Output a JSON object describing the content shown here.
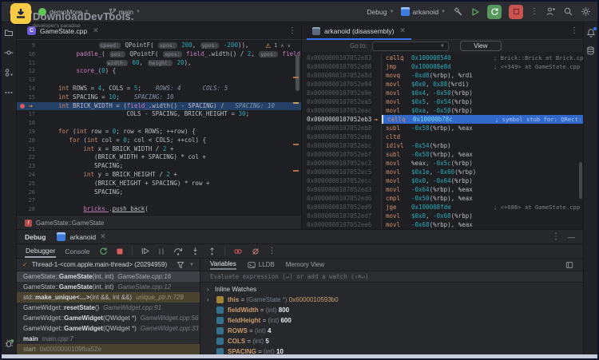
{
  "window": {
    "project": "demoMore",
    "branch": "main"
  },
  "watermark": {
    "title": "DownloadDevTools.",
    "subtitle": "developer's paradise"
  },
  "toolbar": {
    "debug_label": "Debug",
    "run_config": "arkanoid"
  },
  "colors": {
    "accent": "#3574F0",
    "exec_line_editor": "#254066",
    "exec_line_disasm": "#3168C9",
    "run_green": "#57965C",
    "stop_red": "#C75450",
    "breakpoint_red": "#DB5C5C",
    "warning_yellow": "#D9A343",
    "watermark_logo": "#F7CB45"
  },
  "editor_pane": {
    "tab": "GameState.cpp",
    "breadcrumb": "GameState::GameState",
    "warning_count": "1",
    "lines": [
      {
        "n": 9,
        "ind": 15,
        "t": [
          [
            "h",
            "speed:"
          ],
          [
            "d",
            " QPointF( "
          ],
          [
            "h",
            "xpos:"
          ],
          [
            "d",
            " "
          ],
          [
            "n",
            "200"
          ],
          [
            "d",
            ", "
          ],
          [
            "h",
            "ypos:"
          ],
          [
            "d",
            " "
          ],
          [
            "n",
            "-200"
          ],
          [
            "d",
            ")),"
          ]
        ]
      },
      {
        "n": 10,
        "ind": 9,
        "t": [
          [
            "f",
            "paddle_"
          ],
          [
            "d",
            "( "
          ],
          [
            "h",
            "pos:"
          ],
          [
            "d",
            " QPointF( "
          ],
          [
            "h",
            "xpos:"
          ],
          [
            "d",
            " "
          ],
          [
            "f",
            "field_"
          ],
          [
            "d",
            ".width() / "
          ],
          [
            "n",
            "2"
          ],
          [
            "d",
            ", "
          ],
          [
            "h",
            "ypos:"
          ],
          [
            "d",
            " "
          ],
          [
            "f",
            "field_"
          ],
          [
            "d",
            ".height()"
          ]
        ]
      },
      {
        "n": 11,
        "ind": 17,
        "t": [
          [
            "h",
            "width:"
          ],
          [
            "d",
            " "
          ],
          [
            "n",
            "60"
          ],
          [
            "d",
            ", "
          ],
          [
            "h",
            "height:"
          ],
          [
            "d",
            " "
          ],
          [
            "n",
            "20"
          ],
          [
            "d",
            "),"
          ]
        ]
      },
      {
        "n": 12,
        "ind": 9,
        "t": [
          [
            "f",
            "score_"
          ],
          [
            "d",
            "("
          ],
          [
            "n",
            "0"
          ],
          [
            "d",
            ") {"
          ]
        ]
      },
      {
        "n": 13,
        "ind": 0,
        "t": []
      },
      {
        "n": 14,
        "ind": 4,
        "t": [
          [
            "k",
            "int"
          ],
          [
            "d",
            " ROWS = "
          ],
          [
            "n",
            "4"
          ],
          [
            "d",
            ", COLS = "
          ],
          [
            "n",
            "5"
          ],
          [
            "d",
            ";"
          ],
          [
            "g",
            "    ROWS: 4      COLS: 5"
          ]
        ]
      },
      {
        "n": 15,
        "ind": 4,
        "t": [
          [
            "k",
            "int"
          ],
          [
            "d",
            " SPACING = "
          ],
          [
            "n",
            "10"
          ],
          [
            "d",
            ";"
          ],
          [
            "g",
            "    SPACING: 10"
          ]
        ]
      },
      {
        "n": 16,
        "ind": 4,
        "cur": true,
        "bp": true,
        "t": [
          [
            "k",
            "int"
          ],
          [
            "d",
            " BRICK_WIDTH = ("
          ],
          [
            "f",
            "field_"
          ],
          [
            "d",
            ".width() - SPACING) /"
          ],
          [
            "g",
            "   SPACING: 10"
          ]
        ]
      },
      {
        "n": 17,
        "ind": 23,
        "t": [
          [
            "d",
            "COLS - SPACING, BRICK_HEIGHT = "
          ],
          [
            "n",
            "30"
          ],
          [
            "d",
            ";"
          ]
        ]
      },
      {
        "n": 18,
        "ind": 0,
        "t": []
      },
      {
        "n": 19,
        "ind": 4,
        "t": [
          [
            "k",
            "for"
          ],
          [
            "d",
            " ("
          ],
          [
            "k",
            "int"
          ],
          [
            "d",
            " row = "
          ],
          [
            "n",
            "0"
          ],
          [
            "d",
            "; row < ROWS; ++row) {"
          ]
        ]
      },
      {
        "n": 20,
        "ind": 7,
        "t": [
          [
            "k",
            "for"
          ],
          [
            "d",
            " ("
          ],
          [
            "k",
            "int"
          ],
          [
            "d",
            " col = "
          ],
          [
            "n",
            "0"
          ],
          [
            "d",
            "; col < COLS; ++col) {"
          ]
        ]
      },
      {
        "n": 21,
        "ind": 11,
        "t": [
          [
            "k",
            "int"
          ],
          [
            "d",
            " x = BRICK_WIDTH / "
          ],
          [
            "n",
            "2"
          ],
          [
            "d",
            " +"
          ]
        ]
      },
      {
        "n": 22,
        "ind": 14,
        "t": [
          [
            "d",
            "(BRICK_WIDTH + SPACING) * col +"
          ]
        ]
      },
      {
        "n": 23,
        "ind": 14,
        "t": [
          [
            "d",
            "SPACING;"
          ]
        ]
      },
      {
        "n": 24,
        "ind": 11,
        "t": [
          [
            "k",
            "int"
          ],
          [
            "d",
            " y = BRICK_HEIGHT / "
          ],
          [
            "n",
            "2"
          ],
          [
            "d",
            " +"
          ]
        ]
      },
      {
        "n": 25,
        "ind": 14,
        "t": [
          [
            "d",
            "(BRICK_HEIGHT + SPACING) * row +"
          ]
        ]
      },
      {
        "n": 26,
        "ind": 14,
        "t": [
          [
            "d",
            "SPACING;"
          ]
        ]
      },
      {
        "n": 27,
        "ind": 0,
        "t": []
      },
      {
        "n": 28,
        "ind": 11,
        "t": [
          [
            "fu",
            "bricks_"
          ],
          [
            "d",
            "."
          ],
          [
            "u",
            "push_back"
          ],
          [
            "d",
            "("
          ]
        ]
      }
    ]
  },
  "disasm_pane": {
    "tab": "arkanoid (disassembly)",
    "goto_label": "Go to:",
    "view_button": "View",
    "rows": [
      {
        "a": "0x0000000107052e83",
        "m": "callq",
        "o": "0x100008540",
        "c": "; Brick::Brick at Brick.cpp"
      },
      {
        "a": "0x0000000107052e88",
        "m": "jmp",
        "o": "0x100008e8d",
        "c": "; <+349> at GameState.cpp"
      },
      {
        "a": "0x0000000107052e8d",
        "m": "movq",
        "o": "-0xd8(%rbp), %rdi"
      },
      {
        "a": "0x0000000107052e94",
        "m": "movl",
        "o": "$0x0, 0x88(%rdi)"
      },
      {
        "a": "0x0000000107052e9e",
        "m": "movl",
        "o": "$0x4, -0x50(%rbp)"
      },
      {
        "a": "0x0000000107052ea5",
        "m": "movl",
        "o": "$0x5, -0x54(%rbp)"
      },
      {
        "a": "0x0000000107052eac",
        "m": "movl",
        "o": "$0xa, -0x58(%rbp)"
      },
      {
        "a": "0x0000000107052eb3",
        "m": "callq",
        "o": "0x10000b78c",
        "c": "; symbol stub for: QRect:",
        "cur": true
      },
      {
        "a": "0x0000000107052eb8",
        "m": "subl",
        "o": "-0x58(%rbp), %eax"
      },
      {
        "a": "0x0000000107052ebb",
        "m": "cltd",
        "o": ""
      },
      {
        "a": "0x0000000107052ebc",
        "m": "idivl",
        "o": "-0x54(%rbp)"
      },
      {
        "a": "0x0000000107052ebf",
        "m": "subl",
        "o": "-0x58(%rbp), %eax"
      },
      {
        "a": "0x0000000107052ec2",
        "m": "movl",
        "o": "%eax, -0x5c(%rbp)"
      },
      {
        "a": "0x0000000107052ec5",
        "m": "movl",
        "o": "$0x1e, -0x60(%rbp)"
      },
      {
        "a": "0x0000000107052ecc",
        "m": "movl",
        "o": "$0x0, -0x64(%rbp)"
      },
      {
        "a": "0x0000000107052ed3",
        "m": "movl",
        "o": "-0x64(%rbp), %eax"
      },
      {
        "a": "0x0000000107052ed6",
        "m": "cmpl",
        "o": "-0x50(%rbp), %eax"
      },
      {
        "a": "0x0000000107052ed9",
        "m": "jge",
        "o": "0x100008fde",
        "c": "; <+686> at GameState.cpp"
      },
      {
        "a": "0x0000000107052edf",
        "m": "movl",
        "o": "$0x0, -0x68(%rbp)"
      },
      {
        "a": "0x0000000107052ee6",
        "m": "movl",
        "o": "-0x68(%rbp), %eax"
      }
    ]
  },
  "debug_panel": {
    "title": "Debug",
    "tab": "arkanoid",
    "tab_debugger": "Debugger",
    "tab_console": "Console",
    "thread": "Thread-1-<com.apple.main-thread> (20294959)",
    "frames": [
      {
        "pre": "GameState::",
        "name": "GameState",
        "args": "(int, int)",
        "loc": "GameState.cpp:16",
        "sel": true
      },
      {
        "pre": "GameState::",
        "name": "GameState",
        "args": "(int, int)",
        "loc": "GameState.cpp:12"
      },
      {
        "pre": "std::",
        "name": "make_unique<…>",
        "args": "(int &&, int &&)",
        "loc": "unique_ptr.h:728",
        "lib": true
      },
      {
        "pre": "GameWidget::",
        "name": "resetState",
        "args": "()",
        "loc": "GameWidget.cpp:91"
      },
      {
        "pre": "GameWidget::",
        "name": "GameWidget",
        "args": "(QWidget *)",
        "loc": "GameWidget.cpp:56"
      },
      {
        "pre": "GameWidget::",
        "name": "GameWidget",
        "args": "(QWidget *)",
        "loc": "GameWidget.cpp:33"
      },
      {
        "pre": "",
        "name": "main",
        "args": "",
        "loc": "main.cpp:7"
      },
      {
        "pre": "",
        "name": "start",
        "args": "",
        "loc": "0x0000000109fba52e",
        "lib": true,
        "dim": true
      }
    ],
    "right_tabs": [
      "Variables",
      "LLDB",
      "Memory View"
    ],
    "evaluate_placeholder": "Evaluate expression (↵) or add a watch (⇧⌘↵)",
    "inline_watches_label": "Inline Watches",
    "variables": [
      {
        "chev": true,
        "icon": "this",
        "name": "this",
        "type": "(GameState *) ",
        "value": "0x6000010593b0",
        "vcls": "ptr"
      },
      {
        "icon": "int",
        "name": "fieldWidth",
        "type": "(int) ",
        "value": "800"
      },
      {
        "icon": "int",
        "name": "fieldHeight",
        "type": "(int) ",
        "value": "600"
      },
      {
        "icon": "int",
        "name": "ROWS",
        "type": "(int) ",
        "value": "4"
      },
      {
        "icon": "int",
        "name": "COLS",
        "type": "(int) ",
        "value": "5"
      },
      {
        "icon": "int",
        "name": "SPACING",
        "type": "(int) ",
        "value": "10"
      }
    ]
  }
}
